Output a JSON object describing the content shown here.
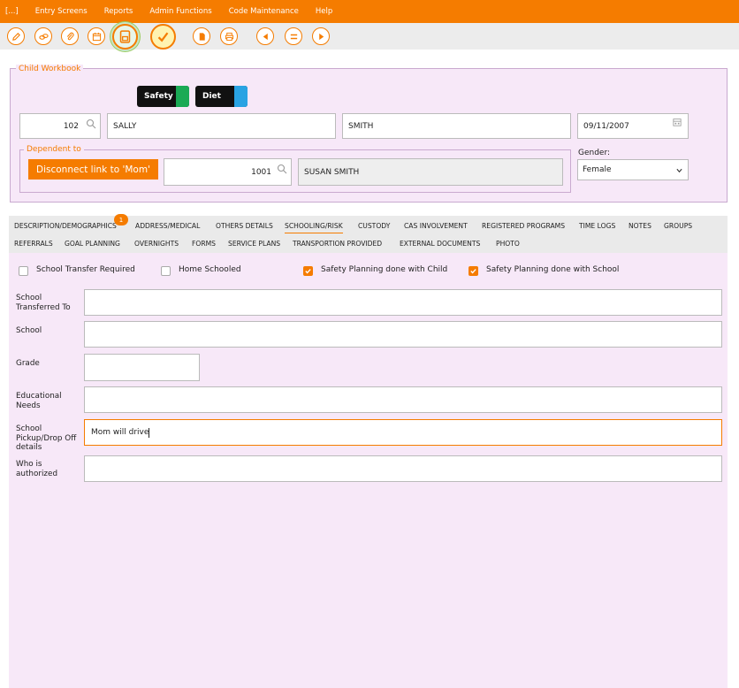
{
  "menu": {
    "items": [
      "[...]",
      "Entry Screens",
      "Reports",
      "Admin Functions",
      "Code Maintenance",
      "Help"
    ]
  },
  "toolbar": {
    "accent": "#f57c00",
    "icons": [
      "edit-icon",
      "link-icon",
      "attach-icon",
      "calendar-icon",
      "save-icon",
      "check-icon",
      "document-icon",
      "print-icon",
      "prev-icon",
      "menu-icon",
      "next-icon"
    ]
  },
  "workbook": {
    "legend": "Child Workbook",
    "pills": {
      "safety": "Safety",
      "safety_color": "#1aaa55",
      "diet": "Diet",
      "diet_color": "#29a3e3"
    },
    "child_id": "102",
    "first_name": "SALLY",
    "last_name": "SMITH",
    "dob": "09/11/2007",
    "dependent": {
      "legend": "Dependent to",
      "disconnect_label": "Disconnect link to 'Mom'",
      "parent_id": "1001",
      "parent_name": "SUSAN SMITH"
    },
    "gender_label": "Gender:",
    "gender_value": "Female"
  },
  "tabs": {
    "row1": [
      "DESCRIPTION/DEMOGRAPHICS",
      "ADDRESS/MEDICAL",
      "OTHERS DETAILS",
      "SCHOOLING/RISK",
      "CUSTODY",
      "CAS INVOLVEMENT",
      "REGISTERED PROGRAMS",
      "TIME LOGS",
      "NOTES",
      "GROUPS"
    ],
    "row2": [
      "REFERRALS",
      "GOAL PLANNING",
      "OVERNIGHTS",
      "FORMS",
      "SERVICE PLANS",
      "TRANSPORTION PROVIDED",
      "EXTERNAL DOCUMENTS",
      "PHOTO"
    ],
    "active": "SCHOOLING/RISK",
    "badge": "1"
  },
  "schooling": {
    "checkboxes": [
      {
        "label": "School Transfer Required",
        "checked": false
      },
      {
        "label": "Home Schooled",
        "checked": false
      },
      {
        "label": "Safety Planning done with Child",
        "checked": true
      },
      {
        "label": "Safety Planning done with School",
        "checked": true
      }
    ],
    "fields": {
      "school_transferred_to": {
        "label": "School Transferred To",
        "value": ""
      },
      "school": {
        "label": "School",
        "value": ""
      },
      "grade": {
        "label": "Grade",
        "value": ""
      },
      "educational_needs": {
        "label": "Educational Needs",
        "value": ""
      },
      "pickup_dropoff": {
        "label": "School Pickup/Drop Off details",
        "value": "Mom will drive"
      },
      "who_is_authorized": {
        "label": "Who is authorized",
        "value": ""
      }
    }
  }
}
